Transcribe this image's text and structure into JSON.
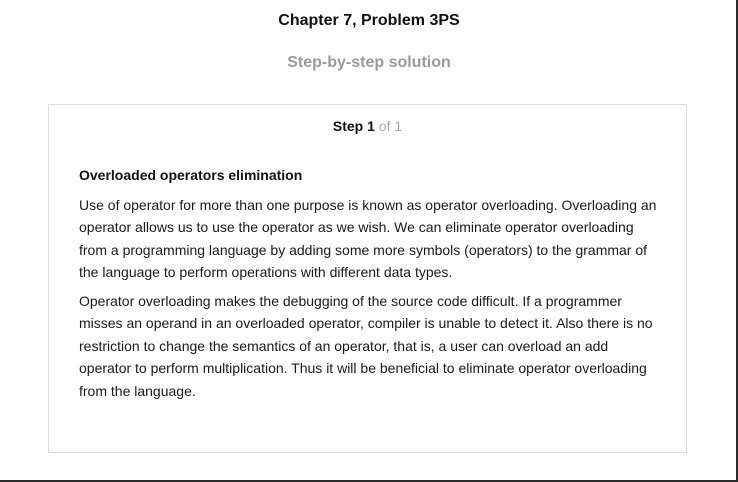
{
  "header": {
    "title": "Chapter 7, Problem 3PS",
    "subtitle": "Step-by-step solution"
  },
  "step": {
    "word": "Step",
    "number": "1",
    "of_text": "of 1"
  },
  "content": {
    "heading": "Overloaded operators elimination",
    "paragraphs": [
      "Use of operator for more than one purpose is known as operator overloading. Overloading an operator allows us to use the operator as we wish. We can eliminate operator overloading from a programming language by adding some more symbols (operators) to the grammar of the language to perform operations with different data types.",
      "Operator overloading makes the debugging of the source code difficult. If a programmer misses an operand in an overloaded operator, compiler is unable to detect it. Also there is no restriction to change the semantics of an operator, that is, a user can overload an add operator to perform multiplication. Thus it will be beneficial to eliminate operator overloading from the language."
    ]
  }
}
